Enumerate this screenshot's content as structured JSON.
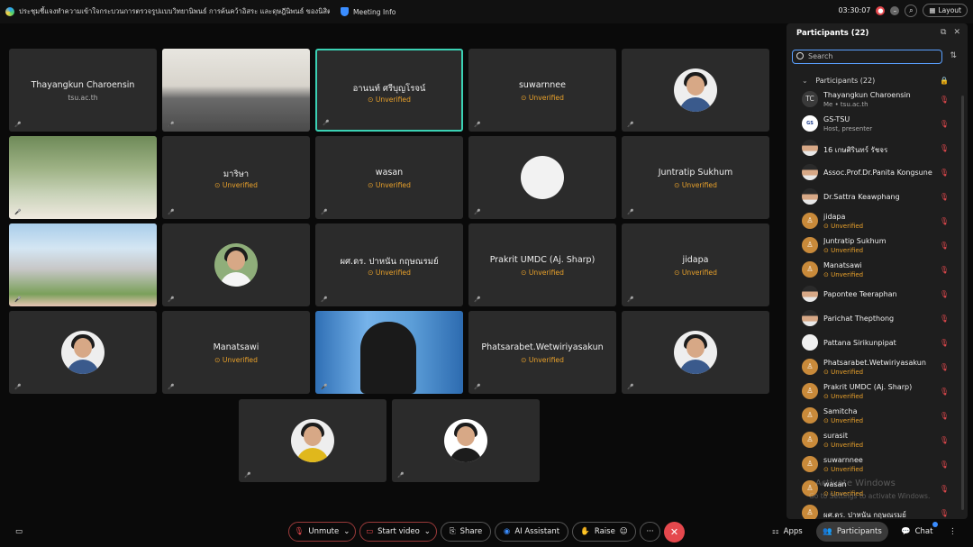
{
  "topbar": {
    "meeting_title": "ประชุมชี้แจงทำความเข้าใจกระบวนการตรวจรูปแบบวิทยานิพนธ์ การค้นคว้าอิสระ และดุษฎีนิพนธ์ ของนิสิตระดับบัณฑิตศึกษา",
    "meeting_info_label": "Meeting Info",
    "timer": "03:30:07",
    "layout_label": "Layout"
  },
  "tiles": [
    {
      "name": "Thayangkun Charoensin",
      "sub": "tsu.ac.th",
      "kind": "name"
    },
    {
      "name": "",
      "kind": "video-room"
    },
    {
      "name": "อานนท์ ศรีบุญโรจน์",
      "unverified": "Unverified",
      "kind": "name",
      "active": true
    },
    {
      "name": "suwarnnee",
      "unverified": "Unverified",
      "kind": "name"
    },
    {
      "name": "",
      "kind": "avatar"
    },
    {
      "name": "",
      "kind": "video-outdoor"
    },
    {
      "name": "มาริษา",
      "unverified": "Unverified",
      "kind": "name"
    },
    {
      "name": "wasan",
      "unverified": "Unverified",
      "kind": "name"
    },
    {
      "name": "",
      "kind": "avatar-plain"
    },
    {
      "name": "Juntratip Sukhum",
      "unverified": "Unverified",
      "kind": "name"
    },
    {
      "name": "",
      "kind": "video-building"
    },
    {
      "name": "",
      "kind": "avatar-sign"
    },
    {
      "name": "ผศ.ดร. ปาหนัน กฤษณรมย์",
      "unverified": "Unverified",
      "kind": "name"
    },
    {
      "name": "Prakrit UMDC (Aj. Sharp)",
      "unverified": "Unverified",
      "kind": "name"
    },
    {
      "name": "jidapa",
      "unverified": "Unverified",
      "kind": "name"
    },
    {
      "name": "",
      "kind": "avatar"
    },
    {
      "name": "Manatsawi",
      "unverified": "Unverified",
      "kind": "name"
    },
    {
      "name": "",
      "kind": "video-person"
    },
    {
      "name": "Phatsarabet.Wetwiriyasakun",
      "unverified": "Unverified",
      "kind": "name"
    },
    {
      "name": "",
      "kind": "avatar"
    },
    {
      "name": "",
      "kind": "avatar-yellow"
    },
    {
      "name": "",
      "kind": "avatar-suit"
    }
  ],
  "panel": {
    "title": "Participants (22)",
    "search_placeholder": "Search",
    "group_label": "Participants (22)",
    "participants": [
      {
        "name": "Thayangkun Charoensin",
        "sub": "Me  •  tsu.ac.th",
        "initials": "TC",
        "av": "tc"
      },
      {
        "name": "GS-TSU",
        "sub": "Host, presenter",
        "initials": "GS",
        "av": "gs"
      },
      {
        "name": "16 เกษศิรินทร์ รัชจร",
        "sub": "",
        "initials": "",
        "av": "photo"
      },
      {
        "name": "Assoc.Prof.Dr.Panita Kongsune",
        "sub": "",
        "initials": "",
        "av": "photo"
      },
      {
        "name": "Dr.Sattra Keawphang",
        "sub": "",
        "initials": "",
        "av": "photo"
      },
      {
        "name": "jidapa",
        "sub": "Unverified",
        "initials": "♙",
        "av": "guest"
      },
      {
        "name": "Juntratip Sukhum",
        "sub": "Unverified",
        "initials": "♙",
        "av": "guest"
      },
      {
        "name": "Manatsawi",
        "sub": "Unverified",
        "initials": "♙",
        "av": "guest"
      },
      {
        "name": "Papontee Teeraphan",
        "sub": "",
        "initials": "",
        "av": "photo"
      },
      {
        "name": "Parichat Thepthong",
        "sub": "",
        "initials": "",
        "av": "photo"
      },
      {
        "name": "Pattana Sirikunpipat",
        "sub": "",
        "initials": "",
        "av": "plain"
      },
      {
        "name": "Phatsarabet.Wetwiriyasakun",
        "sub": "Unverified",
        "initials": "♙",
        "av": "guest"
      },
      {
        "name": "Prakrit UMDC (Aj. Sharp)",
        "sub": "Unverified",
        "initials": "♙",
        "av": "guest"
      },
      {
        "name": "Samitcha",
        "sub": "Unverified",
        "initials": "♙",
        "av": "guest"
      },
      {
        "name": "surasit",
        "sub": "Unverified",
        "initials": "♙",
        "av": "guest"
      },
      {
        "name": "suwarnnee",
        "sub": "Unverified",
        "initials": "♙",
        "av": "guest"
      },
      {
        "name": "wasan",
        "sub": "Unverified",
        "initials": "♙",
        "av": "guest"
      },
      {
        "name": "ผศ.ดร. ปาหนัน กฤษณรมย์",
        "sub": "",
        "initials": "♙",
        "av": "guest"
      }
    ]
  },
  "watermark": {
    "line1": "Activate Windows",
    "line2": "Go to Settings to activate Windows."
  },
  "bottombar": {
    "unmute": "Unmute",
    "start_video": "Start video",
    "share": "Share",
    "ai_assistant": "AI Assistant",
    "raise": "Raise",
    "more": "···",
    "apps": "Apps",
    "participants": "Participants",
    "chat": "Chat"
  },
  "colors": {
    "accent": "#3bd1b4",
    "unverified": "#e9a12b",
    "danger": "#e5484d",
    "search_focus": "#5aa0ff"
  }
}
